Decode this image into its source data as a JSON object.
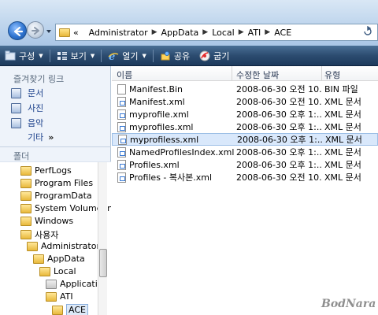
{
  "address": {
    "prefix": "«",
    "crumbs": [
      "Administrator",
      "AppData",
      "Local",
      "ATI",
      "ACE"
    ],
    "end_icon": "refresh-icon"
  },
  "toolbar": {
    "organize": "구성",
    "views": "보기",
    "open": "열기",
    "share": "공유",
    "burn": "굽기"
  },
  "favorites": {
    "header": "즐겨찾기 링크",
    "items": [
      "문서",
      "사진",
      "음악"
    ],
    "more": "기타",
    "more_arrow": "»"
  },
  "folders": {
    "header": "폴더",
    "tree": [
      {
        "label": "PerfLogs"
      },
      {
        "label": "Program Files"
      },
      {
        "label": "ProgramData"
      },
      {
        "label": "System Volume In"
      },
      {
        "label": "Windows"
      },
      {
        "label": "사용자"
      },
      {
        "label": "Administrator"
      },
      {
        "label": "AppData"
      },
      {
        "label": "Local"
      },
      {
        "label": "Applicatio"
      },
      {
        "label": "ATI"
      },
      {
        "label": "ACE"
      }
    ]
  },
  "columns": {
    "name": "이름",
    "date": "수정한 날짜",
    "type": "유형"
  },
  "files": [
    {
      "name": "Manifest.Bin",
      "date": "2008-06-30 오전 10...",
      "type": "BIN 파일"
    },
    {
      "name": "Manifest.xml",
      "date": "2008-06-30 오전 10...",
      "type": "XML 문서"
    },
    {
      "name": "myprofile.xml",
      "date": "2008-06-30 오후 1:...",
      "type": "XML 문서"
    },
    {
      "name": "myprofiles.xml",
      "date": "2008-06-30 오후 1:...",
      "type": "XML 문서"
    },
    {
      "name": "myprofiless.xml",
      "date": "2008-06-30 오후 1:...",
      "type": "XML 문서"
    },
    {
      "name": "NamedProfilesIndex.xml",
      "date": "2008-06-30 오후 1:...",
      "type": "XML 문서"
    },
    {
      "name": "Profiles.xml",
      "date": "2008-06-30 오후 1:...",
      "type": "XML 문서"
    },
    {
      "name": "Profiles - 복사본.xml",
      "date": "2008-06-30 오전 10...",
      "type": "XML 문서"
    }
  ],
  "watermark": "BodNara"
}
